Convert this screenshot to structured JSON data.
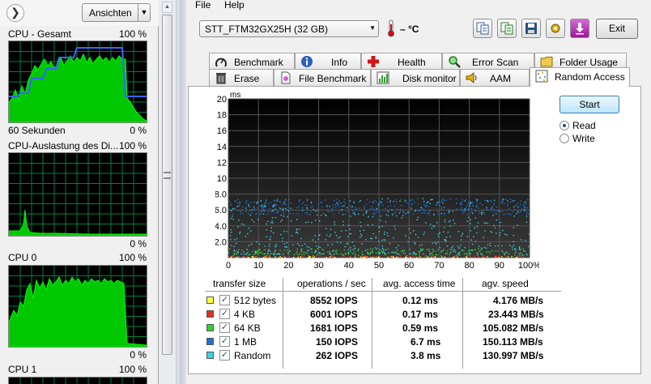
{
  "task_manager": {
    "views_button": "Ansichten",
    "graphs": [
      {
        "title": "CPU - Gesamt",
        "max": "100 %",
        "footer": "60 Sekunden",
        "min": "0 %"
      },
      {
        "title": "CPU-Auslastung des Di...",
        "max": "100 %",
        "min": "0 %"
      },
      {
        "title": "CPU 0",
        "max": "100 %",
        "min": "0 %"
      },
      {
        "title": "CPU 1",
        "max": "100 %"
      }
    ]
  },
  "hdtune": {
    "menu": [
      "File",
      "Help"
    ],
    "drive": "STT_FTM32GX25H (32 GB)",
    "temperature": "– °C",
    "exit_label": "Exit",
    "tabs_row1": [
      "Benchmark",
      "Info",
      "Health",
      "Error Scan",
      "Folder Usage"
    ],
    "tabs_row2": [
      "Erase",
      "File Benchmark",
      "Disk monitor",
      "AAM",
      "Random Access"
    ],
    "active_tab": "Random Access",
    "controls": {
      "start_label": "Start",
      "read_label": "Read",
      "write_label": "Write",
      "mode": "Read"
    },
    "results": {
      "headers": [
        "transfer size",
        "operations / sec",
        "avg. access time",
        "agv. speed"
      ],
      "rows": [
        {
          "label": "512 bytes",
          "color": "#ffff40",
          "ops": "8552 IOPS",
          "time": "0.12 ms",
          "speed": "4.176 MB/s"
        },
        {
          "label": "4 KB",
          "color": "#e03020",
          "ops": "6001 IOPS",
          "time": "0.17 ms",
          "speed": "23.443 MB/s"
        },
        {
          "label": "64 KB",
          "color": "#30d030",
          "ops": "1681 IOPS",
          "time": "0.59 ms",
          "speed": "105.082 MB/s"
        },
        {
          "label": "1 MB",
          "color": "#2070d0",
          "ops": "150 IOPS",
          "time": "6.7 ms",
          "speed": "150.113 MB/s"
        },
        {
          "label": "Random",
          "color": "#40d0e0",
          "ops": "262 IOPS",
          "time": "3.8 ms",
          "speed": "130.997 MB/s"
        }
      ]
    }
  },
  "chart_data": {
    "type": "scatter",
    "ylabel": "ms",
    "y_ticks": [
      "20",
      "18",
      "16",
      "14",
      "12",
      "10",
      "8.0",
      "6.0",
      "4.0",
      "2.0"
    ],
    "x_ticks": [
      "0",
      "10",
      "20",
      "30",
      "40",
      "50",
      "60",
      "70",
      "80",
      "90",
      "100%"
    ],
    "xlim": [
      0,
      100
    ],
    "ylim": [
      0,
      20
    ],
    "grid": true,
    "series": [
      {
        "name": "512 bytes",
        "color": "#ffff40",
        "y_band": [
          0.05,
          0.2
        ]
      },
      {
        "name": "4 KB",
        "color": "#e03020",
        "y_band": [
          0.1,
          0.3
        ]
      },
      {
        "name": "64 KB",
        "color": "#30d030",
        "y_band": [
          0.3,
          1.2
        ]
      },
      {
        "name": "1 MB",
        "color": "#2070d0",
        "y_band": [
          5.5,
          7.5
        ]
      },
      {
        "name": "Random",
        "color": "#40d0e0",
        "y_band": [
          0.5,
          7.5
        ]
      }
    ]
  }
}
